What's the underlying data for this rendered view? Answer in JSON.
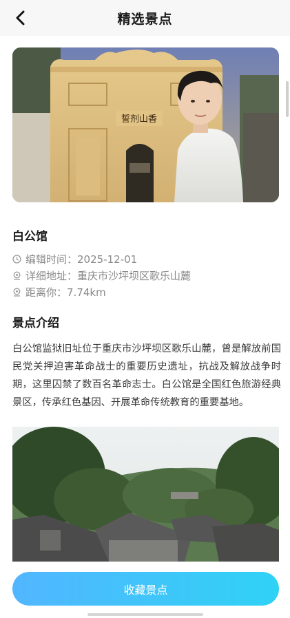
{
  "header": {
    "title": "精选景点",
    "back_icon": "chevron-left-icon"
  },
  "hero": {
    "sign_text": "誓剂山香"
  },
  "spot": {
    "name": "白公馆",
    "date_label": "编辑时间：",
    "date": "2025-12-01",
    "address_label": "详细地址：",
    "address": "重庆市沙坪坝区歌乐山麓",
    "distance_label": "距离你：",
    "distance": "7.74km"
  },
  "intro": {
    "title": "景点介绍",
    "text": "白公馆监狱旧址位于重庆市沙坪坝区歌乐山麓，曾是解放前国民党关押迫害革命战士的重要历史遗址，抗战及解放战争时期，这里囚禁了数百名革命志士。白公馆是全国红色旅游经典景区，传承红色基因、开展革命传统教育的重要基地。"
  },
  "actions": {
    "collect_label": "收藏景点"
  },
  "colors": {
    "button_start": "#52b6ff",
    "button_end": "#2fd2f5",
    "muted_text": "#8a8a8a"
  }
}
